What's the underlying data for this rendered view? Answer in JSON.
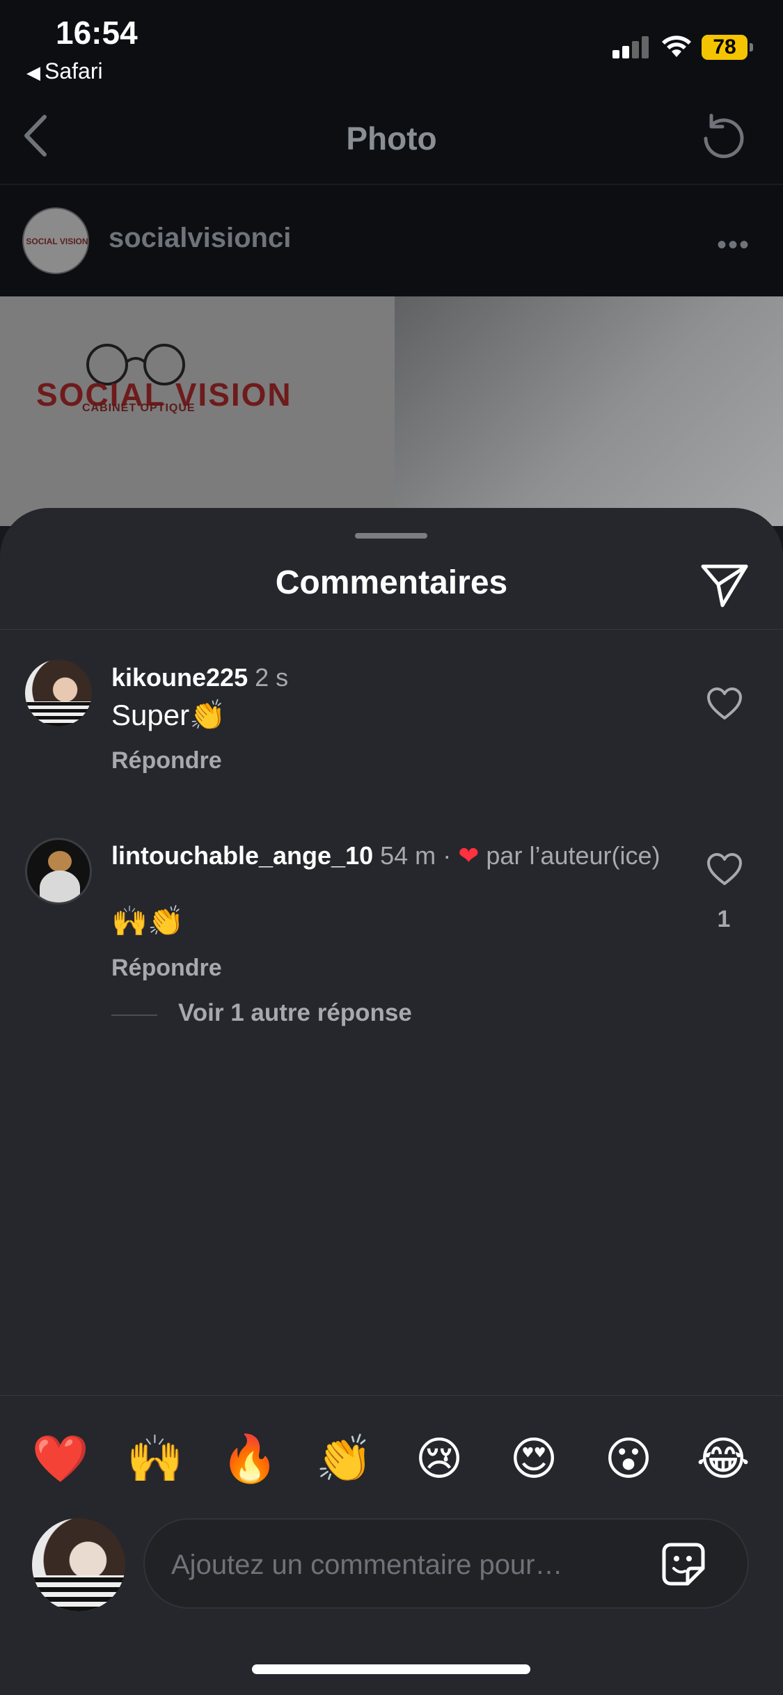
{
  "status_bar": {
    "time": "16:54",
    "back_app": "Safari",
    "battery": "78",
    "battery_color": "#f5c400"
  },
  "nav": {
    "title": "Photo",
    "back_icon": "chevron-left-icon",
    "refresh_icon": "refresh-icon"
  },
  "post": {
    "username": "socialvisionci",
    "more_icon": "more-horizontal-icon",
    "logo_text": "SOCIAL VISION",
    "logo_subtext": "CABINET OPTIQUE"
  },
  "sheet": {
    "title": "Commentaires",
    "share_icon": "paper-plane-icon"
  },
  "comments": [
    {
      "username": "kikoune225",
      "time": "2 s",
      "text": "Super👏",
      "reply_label": "Répondre",
      "likes": ""
    },
    {
      "username": "lintouchable_ange_10",
      "time": "54 m",
      "separator": "·",
      "liked_by_author_heart": "❤",
      "liked_by_author_label": "par l’auteur(ice)",
      "text": "🙌👏",
      "reply_label": "Répondre",
      "likes": "1",
      "more_replies": "Voir 1 autre réponse"
    }
  ],
  "quick_reactions": [
    "❤️",
    "🙌",
    "🔥",
    "👏",
    "😢",
    "😍",
    "😮",
    "😂"
  ],
  "composer": {
    "placeholder": "Ajoutez un commentaire pour…",
    "value": "",
    "sticker_icon": "sticker-icon"
  },
  "colors": {
    "sheet_bg": "#25272c",
    "accent_heart": "#ff3040",
    "secondary_text": "#a6a9ae"
  }
}
